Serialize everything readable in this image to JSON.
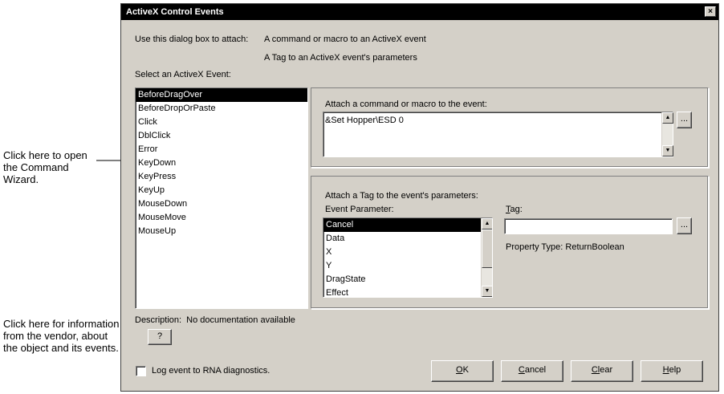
{
  "callouts": {
    "command_wizard": "Click here to open the Command Wizard.",
    "vendor_info": "Click here for information from the vendor, about the object and its events."
  },
  "dialog": {
    "title": "ActiveX Control Events",
    "close_glyph": "×",
    "intro_prefix": "Use this dialog box to attach:",
    "intro_option1": "A command or macro to an ActiveX event",
    "intro_option2": "A Tag to an ActiveX event's parameters",
    "select_event_label": "Select an ActiveX Event:",
    "events": [
      "BeforeDragOver",
      "BeforeDropOrPaste",
      "Click",
      "DblClick",
      "Error",
      "KeyDown",
      "KeyPress",
      "KeyUp",
      "MouseDown",
      "MouseMove",
      "MouseUp"
    ],
    "selected_event": "BeforeDragOver",
    "command_group_label": "Attach a command or macro to the event:",
    "command_value": "&Set Hopper\\ESD 0",
    "browse_glyph": "...",
    "tag_group_label": "Attach a Tag to the event's parameters:",
    "event_param_label": "Event Parameter:",
    "event_params": [
      "Cancel",
      "Data",
      "X",
      "Y",
      "DragState",
      "Effect"
    ],
    "selected_param": "Cancel",
    "tag_label_u": "T",
    "tag_label_rest": "ag:",
    "tag_value": "",
    "property_type_label": "Property Type:",
    "property_type_value": "ReturnBoolean",
    "description_label": "Description:",
    "description_value": "No documentation available",
    "help_q": "?",
    "log_label": "Log event to RNA diagnostics.",
    "log_checked": false,
    "ok_u": "O",
    "ok_rest": "K",
    "cancel_u": "C",
    "cancel_rest": "ancel",
    "clear_u": "Cl",
    "clear_rest": "ear",
    "help_u": "H",
    "help_rest": "elp",
    "scroll_up": "▲",
    "scroll_down": "▼"
  }
}
